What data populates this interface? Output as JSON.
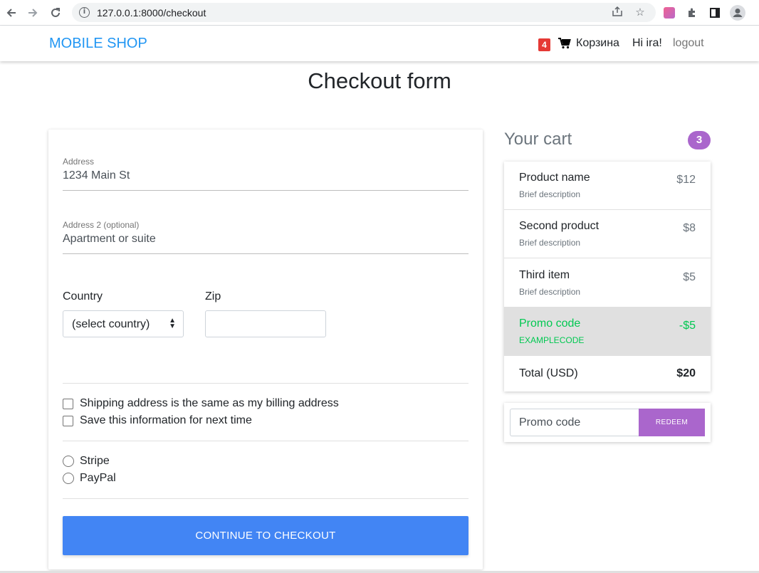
{
  "browser": {
    "url": "127.0.0.1:8000/checkout"
  },
  "navbar": {
    "brand": "MOBILE SHOP",
    "cart_count": "4",
    "cart_label": "Корзина",
    "greeting": "Hi ira!",
    "logout": "logout"
  },
  "page": {
    "title": "Checkout form"
  },
  "form": {
    "address_label": "Address",
    "address_placeholder": "1234 Main St",
    "address2_label": "Address 2 (optional)",
    "address2_placeholder": "Apartment or suite",
    "country_label": "Country",
    "country_selected": "(select country)",
    "zip_label": "Zip",
    "zip_value": "",
    "checkbox_same_address": "Shipping address is the same as my billing address",
    "checkbox_save_info": "Save this information for next time",
    "payment_options": [
      "Stripe",
      "PayPal"
    ],
    "submit_label": "CONTINUE TO CHECKOUT"
  },
  "cart": {
    "heading": "Your cart",
    "count": "3",
    "items": [
      {
        "name": "Product name",
        "description": "Brief description",
        "price": "$12"
      },
      {
        "name": "Second product",
        "description": "Brief description",
        "price": "$8"
      },
      {
        "name": "Third item",
        "description": "Brief description",
        "price": "$5"
      }
    ],
    "promo": {
      "name": "Promo code",
      "code": "EXAMPLECODE",
      "amount": "-$5"
    },
    "total_label": "Total (USD)",
    "total_value": "$20",
    "promo_placeholder": "Promo code",
    "redeem_label": "REDEEM"
  },
  "colors": {
    "brand": "#2196f3",
    "primary_button": "#4285f4",
    "secondary": "#aa66cc",
    "promo_green": "#00c851",
    "badge_red": "#e53935"
  }
}
